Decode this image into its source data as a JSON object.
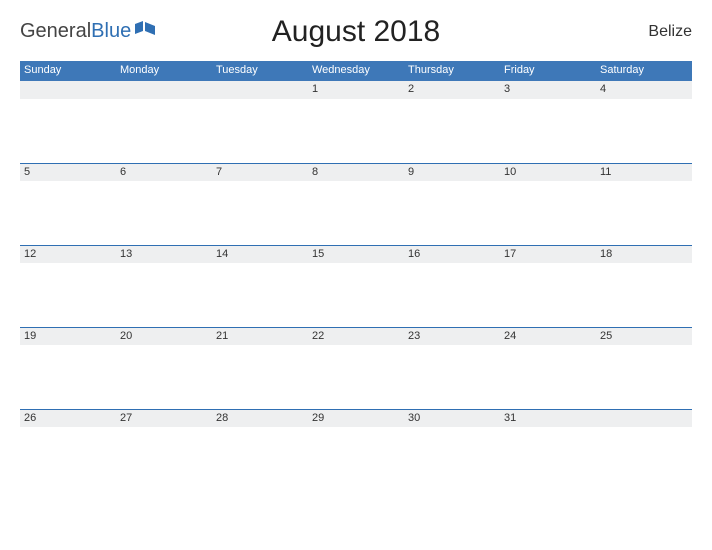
{
  "brand": {
    "part1": "General",
    "part2": "Blue"
  },
  "title": "August 2018",
  "region": "Belize",
  "day_names": [
    "Sunday",
    "Monday",
    "Tuesday",
    "Wednesday",
    "Thursday",
    "Friday",
    "Saturday"
  ],
  "weeks": [
    [
      "",
      "",
      "",
      "1",
      "2",
      "3",
      "4"
    ],
    [
      "5",
      "6",
      "7",
      "8",
      "9",
      "10",
      "11"
    ],
    [
      "12",
      "13",
      "14",
      "15",
      "16",
      "17",
      "18"
    ],
    [
      "19",
      "20",
      "21",
      "22",
      "23",
      "24",
      "25"
    ],
    [
      "26",
      "27",
      "28",
      "29",
      "30",
      "31",
      ""
    ]
  ]
}
